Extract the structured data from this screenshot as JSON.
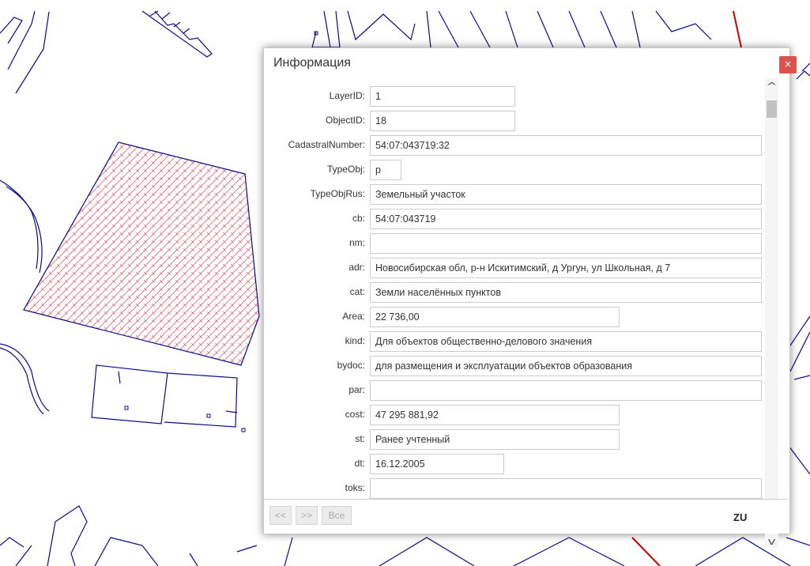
{
  "dialog": {
    "title": "Информация",
    "close_label": "×",
    "fields": [
      {
        "label": "LayerID:",
        "value": "1"
      },
      {
        "label": "ObjectID:",
        "value": "18"
      },
      {
        "label": "CadastralNumber:",
        "value": "54:07:043719:32"
      },
      {
        "label": "TypeObj:",
        "value": "p"
      },
      {
        "label": "TypeObjRus:",
        "value": "Земельный участок"
      },
      {
        "label": "cb:",
        "value": "54:07:043719"
      },
      {
        "label": "nm:",
        "value": ""
      },
      {
        "label": "adr:",
        "value": "Новосибирская обл, р-н Искитимский, д Ургун, ул Школьная, д 7"
      },
      {
        "label": "cat:",
        "value": "Земли населённых пунктов"
      },
      {
        "label": "Area:",
        "value": "22 736,00"
      },
      {
        "label": "kind:",
        "value": "Для объектов общественно-делового значения"
      },
      {
        "label": "bydoc:",
        "value": "для размещения и эксплуатации объектов образования"
      },
      {
        "label": "par:",
        "value": ""
      },
      {
        "label": "cost:",
        "value": "47 295 881,92"
      },
      {
        "label": "st:",
        "value": "Ранее учтенный"
      },
      {
        "label": "dt:",
        "value": "16.12.2005"
      },
      {
        "label": "toks:",
        "value": ""
      }
    ],
    "footer": {
      "prev_label": "<<",
      "next_label": ">>",
      "all_label": "Все",
      "layer_tag": "ZU"
    },
    "scroll_up_icon": "chevron-up-icon",
    "scroll_down_icon": "chevron-down-icon"
  },
  "map": {
    "line_color": "#0a0a8a",
    "highlight_color": "#cc0000",
    "parcel_hatch_color": "#e8606a"
  }
}
